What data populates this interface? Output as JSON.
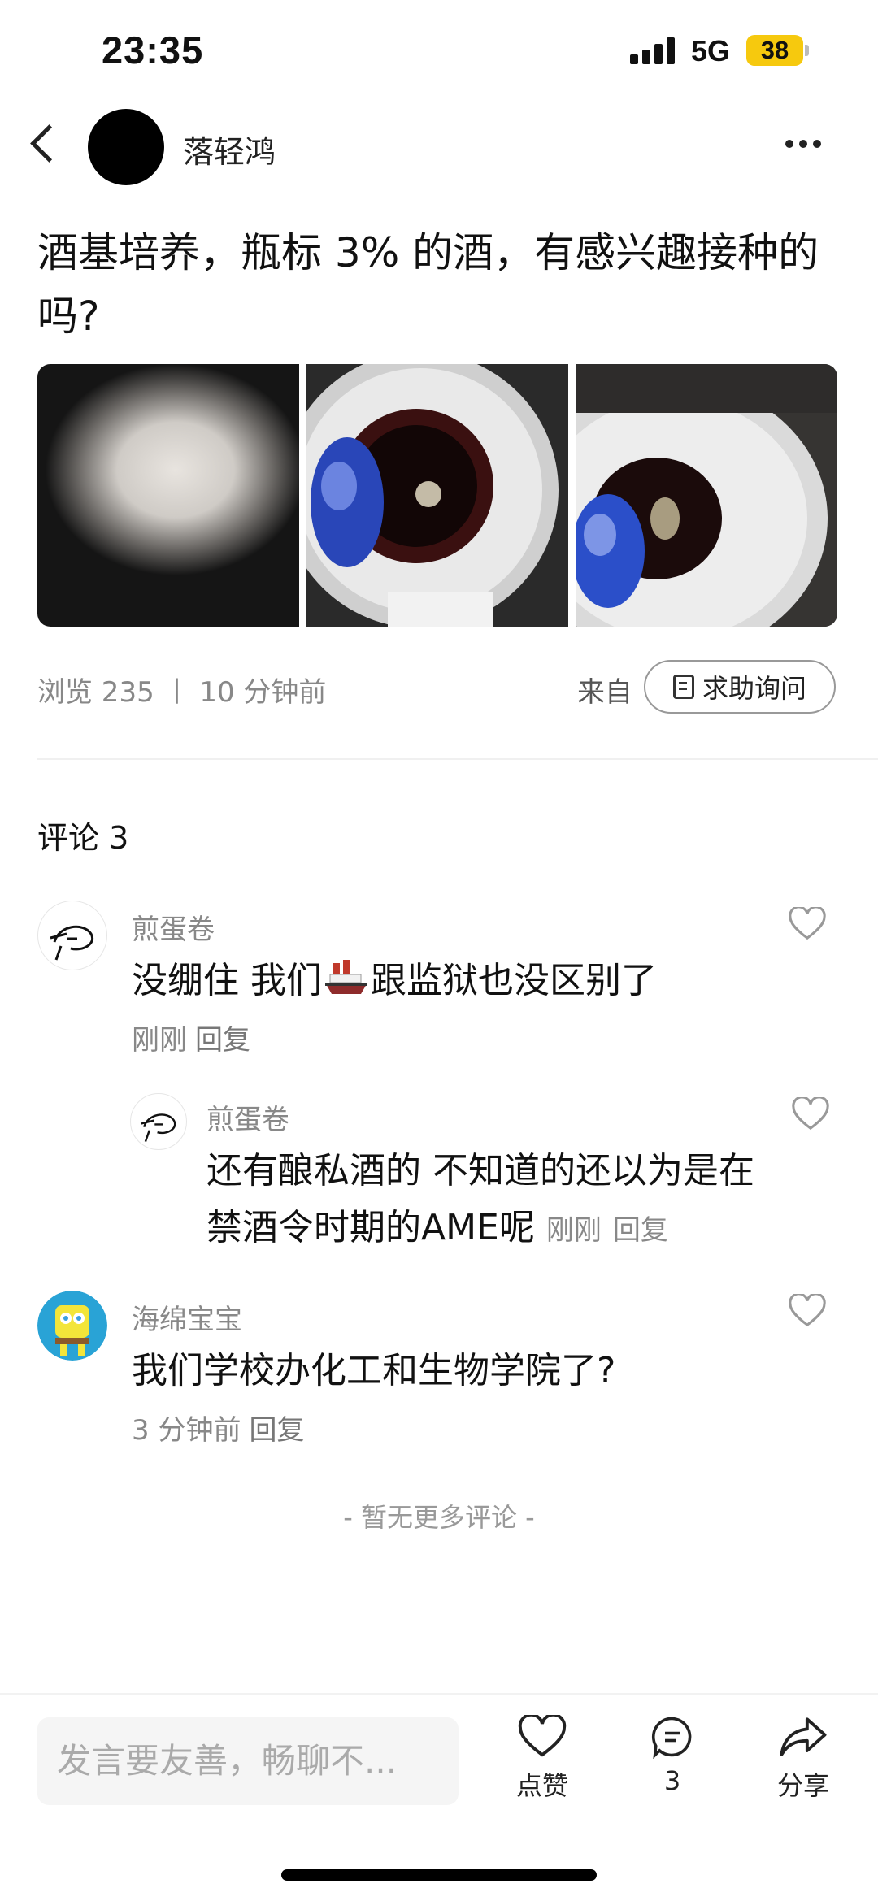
{
  "status_bar": {
    "time": "23:35",
    "network": "5G",
    "battery": "38"
  },
  "header": {
    "author": "落轻鸿"
  },
  "post": {
    "title": "酒基培养，瓶标 3% 的酒，有感兴趣接种的吗?",
    "meta": "浏览 235 丨 10 分钟前",
    "from_label": "来自",
    "source_button": "求助询问"
  },
  "comments_header": "评论 3",
  "comments": [
    {
      "name": "煎蛋卷",
      "text_before": "没绷住 我们",
      "text_after": "跟监狱也没区别了",
      "time": "刚刚",
      "reply": "回复"
    },
    {
      "name": "煎蛋卷",
      "line1": "还有酿私酒的 不知道的还以为是在",
      "line2": "禁酒令时期的AME呢",
      "time": "刚刚",
      "reply": "回复"
    },
    {
      "name": "海绵宝宝",
      "text": "我们学校办化工和生物学院了?",
      "time": "3 分钟前",
      "reply": "回复"
    }
  ],
  "no_more": "- 暂无更多评论 -",
  "bottom_bar": {
    "input_placeholder": "发言要友善，畅聊不...",
    "like_label": "点赞",
    "comment_count": "3",
    "share_label": "分享"
  }
}
